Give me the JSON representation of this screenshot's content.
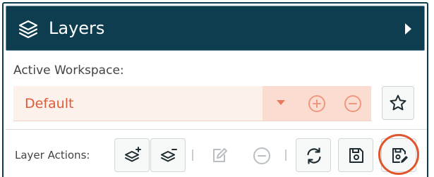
{
  "panel": {
    "title": "Layers",
    "title_icon": "layers-icon",
    "collapse_icon": "caret-right-icon"
  },
  "workspace": {
    "label": "Active Workspace:",
    "selected": "Default",
    "controls": [
      "caret-down-icon",
      "plus-circle-icon",
      "minus-circle-icon"
    ],
    "favorite_icon": "star-icon"
  },
  "layer_actions": {
    "label": "Layer Actions:",
    "buttons": [
      {
        "icon": "add-layer-icon",
        "enabled": true
      },
      {
        "icon": "remove-layer-icon",
        "enabled": true
      },
      {
        "icon": "edit-icon",
        "enabled": false
      },
      {
        "icon": "minus-circle-icon",
        "enabled": false
      },
      {
        "icon": "refresh-icon",
        "enabled": true
      },
      {
        "icon": "save-icon",
        "enabled": true
      },
      {
        "icon": "save-edit-icon",
        "enabled": true,
        "highlighted": true
      }
    ]
  },
  "colors": {
    "header_bg": "#0e3d4f",
    "accent": "#e05a3a",
    "select_bg": "#fdf1ec",
    "highlight": "#e0552c"
  }
}
